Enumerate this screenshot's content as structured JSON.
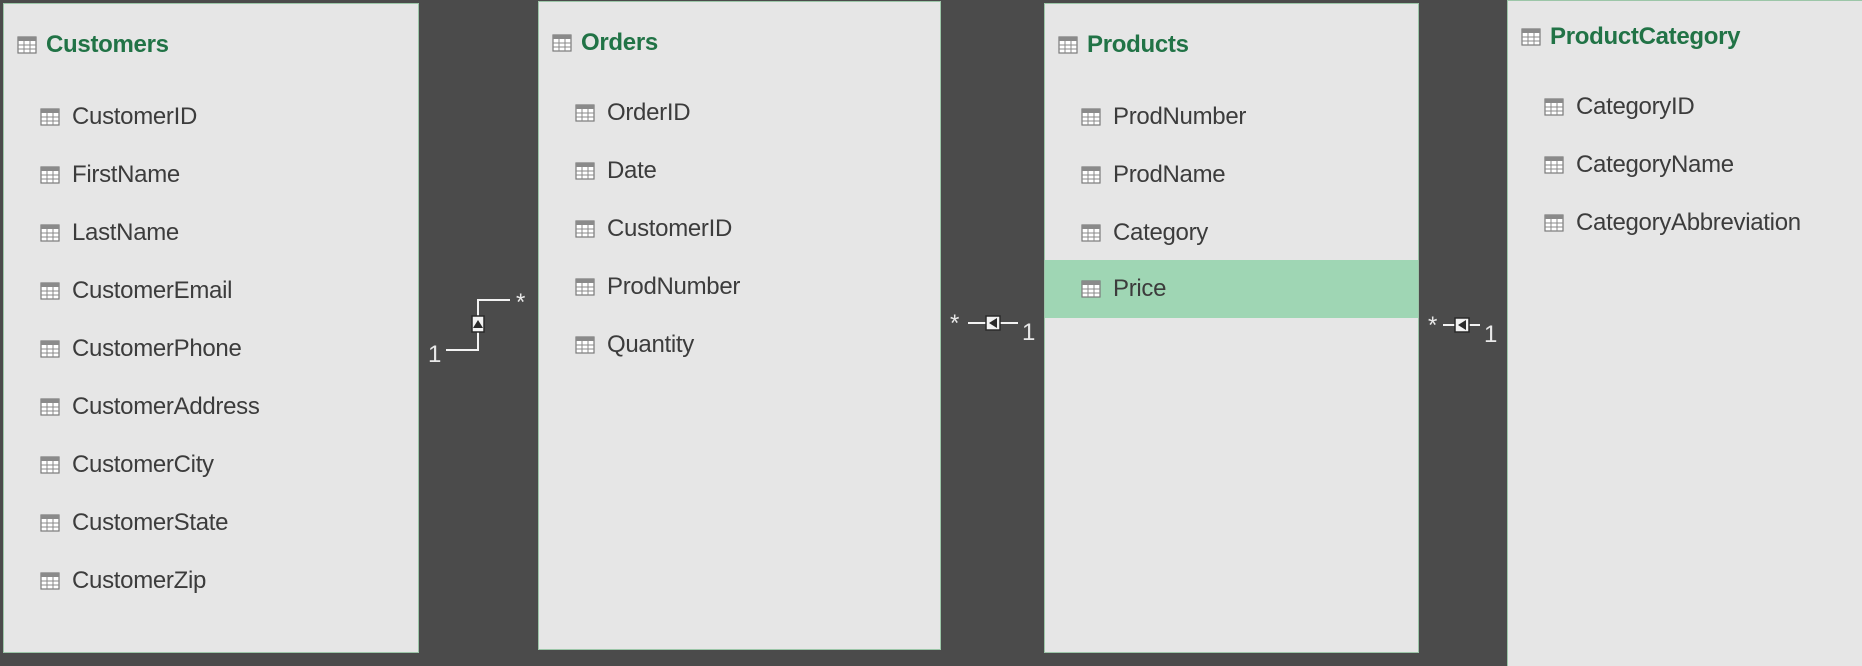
{
  "colors": {
    "canvas": "#4b4b4b",
    "table_bg": "#e6e6e6",
    "table_title": "#217346",
    "field_text": "#3c3c3c",
    "selected_row": "#9fd6b4",
    "connector": "#f2f2f2"
  },
  "icons": {
    "table": "table-grid-icon",
    "column": "column-grid-icon"
  },
  "tables": [
    {
      "name": "Customers",
      "fields": [
        "CustomerID",
        "FirstName",
        "LastName",
        "CustomerEmail",
        "CustomerPhone",
        "CustomerAddress",
        "CustomerCity",
        "CustomerState",
        "CustomerZip"
      ]
    },
    {
      "name": "Orders",
      "fields": [
        "OrderID",
        "Date",
        "CustomerID",
        "ProdNumber",
        "Quantity"
      ]
    },
    {
      "name": "Products",
      "fields": [
        "ProdNumber",
        "ProdName",
        "Category",
        "Price"
      ],
      "selected_field": "Price"
    },
    {
      "name": "ProductCategory",
      "fields": [
        "CategoryID",
        "CategoryName",
        "CategoryAbbreviation"
      ]
    }
  ],
  "relationships": [
    {
      "from_table": "Customers",
      "to_table": "Orders",
      "one_label": "1",
      "many_label": "*"
    },
    {
      "from_table": "Orders",
      "to_table": "Products",
      "many_label": "*",
      "one_label": "1"
    },
    {
      "from_table": "Products",
      "to_table": "ProductCategory",
      "many_label": "*",
      "one_label": "1"
    }
  ]
}
